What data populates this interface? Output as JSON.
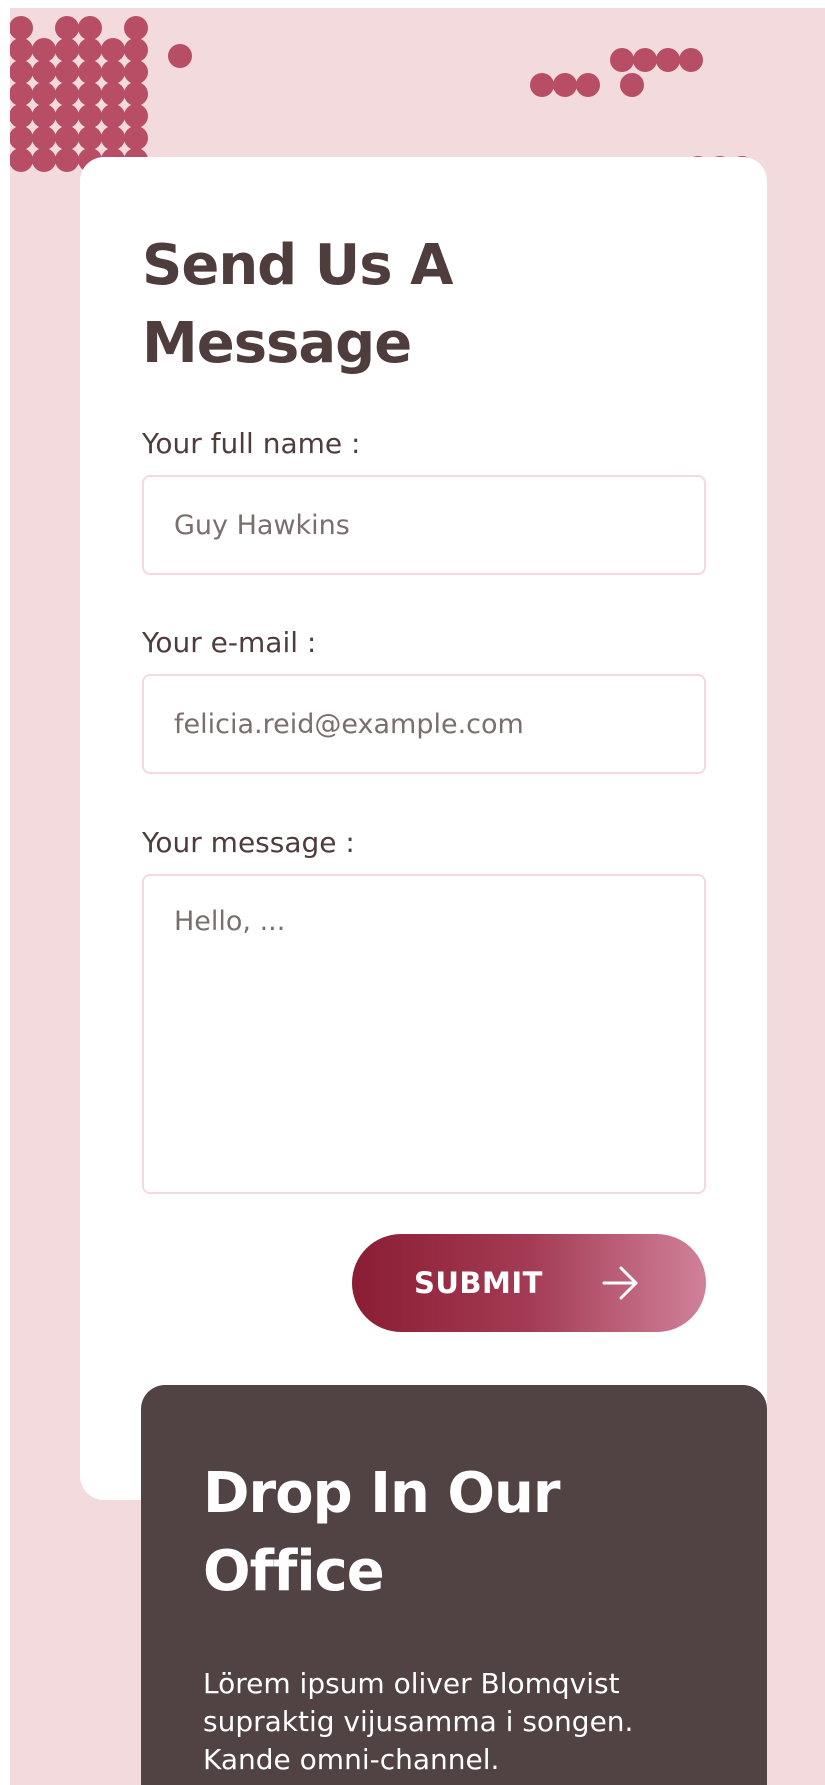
{
  "colors": {
    "page_background": "#f3dbdd",
    "dot_pattern": "#b84d66",
    "heading_text": "#4f3c3d",
    "input_border": "#f5d9df",
    "submit_gradient_start": "#8a1d33",
    "submit_gradient_end": "#d1819a",
    "office_card_background": "#514343"
  },
  "contact_form": {
    "title": "Send Us A Message",
    "name_label": "Your full name :",
    "name_placeholder": "Guy Hawkins",
    "email_label": "Your e-mail :",
    "email_placeholder": "felicia.reid@example.com",
    "message_label": "Your message :",
    "message_placeholder": "Hello, ...",
    "submit_label": "SUBMIT",
    "submit_icon": "arrow-right-icon"
  },
  "office": {
    "title": "Drop In Our Office",
    "text": "Lörem ipsum oliver Blomqvist supraktig vijusamma i songen. Kande omni-channel."
  }
}
